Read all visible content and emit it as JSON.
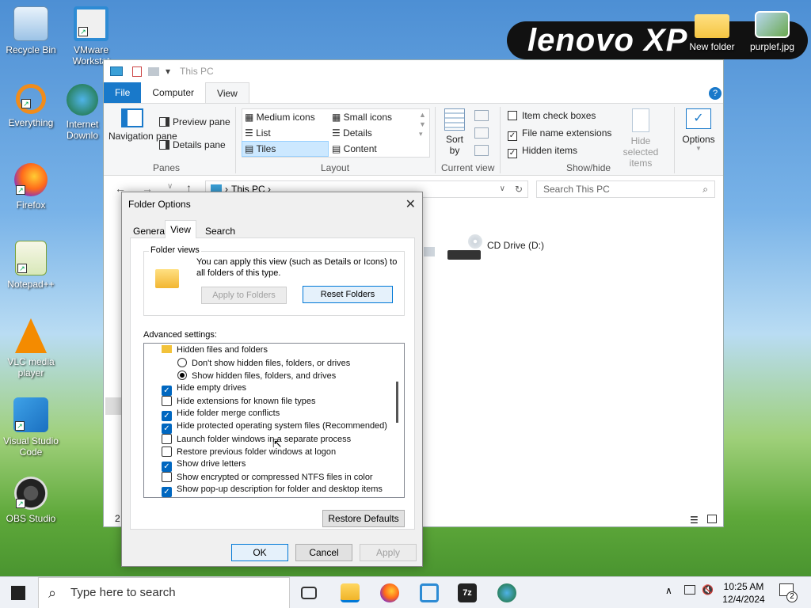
{
  "desktop": {
    "icons": [
      {
        "label": "Recycle Bin"
      },
      {
        "label": "VMware Workstat"
      },
      {
        "label": "Everything"
      },
      {
        "label": "Internet Downlo"
      },
      {
        "label": "Firefox"
      },
      {
        "label": "Notepad++"
      },
      {
        "label": "VLC media player"
      },
      {
        "label": "Visual Studio Code"
      },
      {
        "label": "OBS Studio"
      },
      {
        "label": "New folder"
      },
      {
        "label": "purplef.jpg"
      }
    ],
    "banner_text": "lenovo XP"
  },
  "explorer": {
    "title": "This PC",
    "tabs": [
      "File",
      "Computer",
      "View"
    ],
    "ribbon": {
      "panes": {
        "navigation_pane": "Navigation pane",
        "preview_pane": "Preview pane",
        "details_pane": "Details pane",
        "group_label": "Panes"
      },
      "layout": {
        "items": [
          "Medium icons",
          "Small icons",
          "List",
          "Details",
          "Tiles",
          "Content"
        ],
        "group_label": "Layout"
      },
      "current_view": {
        "sort_by": "Sort by",
        "group_label": "Current view"
      },
      "show_hide": {
        "item_check_boxes": "Item check boxes",
        "file_name_extensions": "File name extensions",
        "hidden_items": "Hidden items",
        "hide_selected_items": "Hide selected items",
        "group_label": "Show/hide"
      },
      "options": "Options"
    },
    "address": "This PC",
    "search_placeholder": "Search This PC",
    "drive_label": "CD Drive (D:)",
    "status_count": "2"
  },
  "dialog": {
    "title": "Folder Options",
    "tabs": [
      "General",
      "View",
      "Search"
    ],
    "folder_views": {
      "legend": "Folder views",
      "description": "You can apply this view (such as Details or Icons) to all folders of this type.",
      "apply_button": "Apply to Folders",
      "reset_button": "Reset Folders"
    },
    "advanced_label": "Advanced settings:",
    "settings": [
      {
        "label": "Hidden files and folders",
        "kind": "folder"
      },
      {
        "label": "Don't show hidden files, folders, or drives",
        "kind": "radio",
        "checked": false
      },
      {
        "label": "Show hidden files, folders, and drives",
        "kind": "radio",
        "checked": true
      },
      {
        "label": "Hide empty drives",
        "kind": "check",
        "checked": true
      },
      {
        "label": "Hide extensions for known file types",
        "kind": "check",
        "checked": false
      },
      {
        "label": "Hide folder merge conflicts",
        "kind": "check",
        "checked": true
      },
      {
        "label": "Hide protected operating system files (Recommended)",
        "kind": "check",
        "checked": true
      },
      {
        "label": "Launch folder windows in a separate process",
        "kind": "check",
        "checked": false
      },
      {
        "label": "Restore previous folder windows at logon",
        "kind": "check",
        "checked": false
      },
      {
        "label": "Show drive letters",
        "kind": "check",
        "checked": true
      },
      {
        "label": "Show encrypted or compressed NTFS files in color",
        "kind": "check",
        "checked": false
      },
      {
        "label": "Show pop-up description for folder and desktop items",
        "kind": "check",
        "checked": true
      }
    ],
    "restore_defaults": "Restore Defaults",
    "ok": "OK",
    "cancel": "Cancel",
    "apply": "Apply"
  },
  "taskbar": {
    "search_placeholder": "Type here to search",
    "time": "10:25 AM",
    "date": "12/4/2024",
    "notification_count": "2",
    "archiver_label": "7z"
  },
  "colors": {
    "accent": "#1979ca",
    "checkbox": "#0067c0"
  }
}
